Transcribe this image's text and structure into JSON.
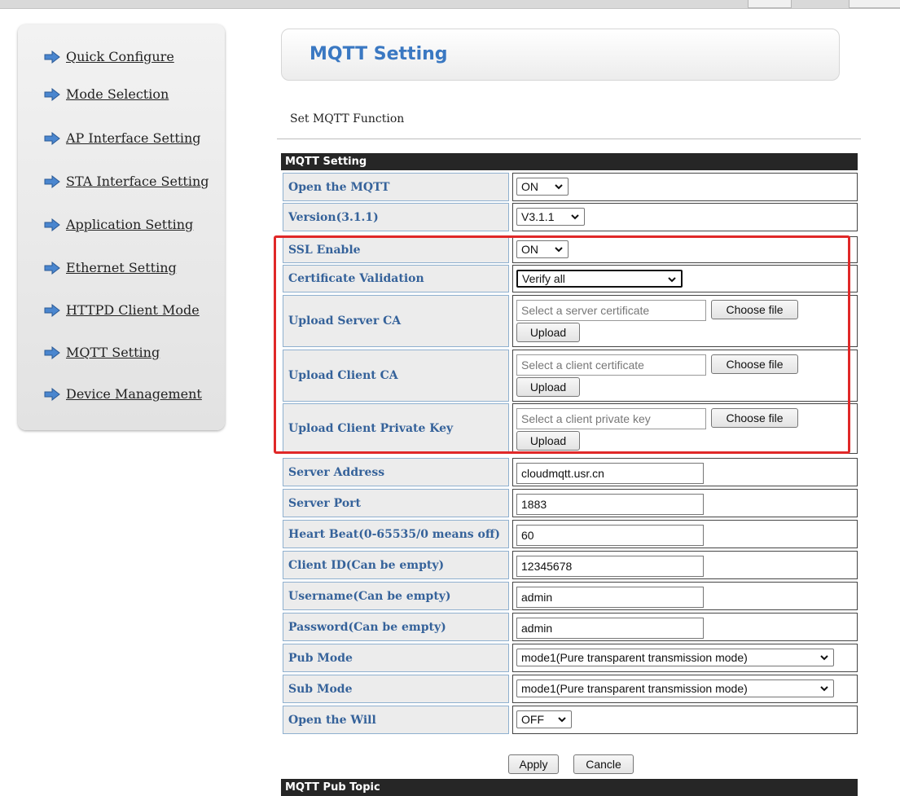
{
  "sidebar": {
    "items": [
      {
        "label": "Quick Configure"
      },
      {
        "label": "Mode Selection"
      },
      {
        "label": "AP Interface Setting"
      },
      {
        "label": "STA Interface Setting"
      },
      {
        "label": "Application Setting"
      },
      {
        "label": "Ethernet Setting"
      },
      {
        "label": "HTTPD Client Mode"
      },
      {
        "label": "MQTT Setting"
      },
      {
        "label": "Device Management"
      }
    ]
  },
  "header": {
    "title": "MQTT Setting"
  },
  "subtitle": "Set MQTT Function",
  "section": {
    "title": "MQTT Setting",
    "next_title": "MQTT Pub Topic"
  },
  "fields": {
    "open_mqtt": {
      "label": "Open the MQTT",
      "value": "ON"
    },
    "version": {
      "label": "Version(3.1.1)",
      "value": "V3.1.1"
    },
    "ssl_enable": {
      "label": "SSL Enable",
      "value": "ON"
    },
    "cert_validation": {
      "label": "Certificate Validation",
      "value": "Verify all"
    },
    "server_ca": {
      "label": "Upload Server CA",
      "placeholder": "Select a server certificate",
      "choose": "Choose file",
      "upload": "Upload"
    },
    "client_ca": {
      "label": "Upload Client CA",
      "placeholder": "Select a client certificate",
      "choose": "Choose file",
      "upload": "Upload"
    },
    "client_key": {
      "label": "Upload Client Private Key",
      "placeholder": "Select a client private key",
      "choose": "Choose file",
      "upload": "Upload"
    },
    "server_address": {
      "label": "Server Address",
      "value": "cloudmqtt.usr.cn"
    },
    "server_port": {
      "label": "Server Port",
      "value": "1883"
    },
    "heart_beat": {
      "label": "Heart Beat(0-65535/0 means off)",
      "value": "60"
    },
    "client_id": {
      "label": "Client ID(Can be empty)",
      "value": "12345678"
    },
    "username": {
      "label": "Username(Can be empty)",
      "value": "admin"
    },
    "password": {
      "label": "Password(Can be empty)",
      "value": "admin"
    },
    "pub_mode": {
      "label": "Pub Mode",
      "value": "mode1(Pure transparent transmission mode)"
    },
    "sub_mode": {
      "label": "Sub Mode",
      "value": "mode1(Pure transparent transmission mode)"
    },
    "open_will": {
      "label": "Open the Will",
      "value": "OFF"
    }
  },
  "actions": {
    "apply": "Apply",
    "cancel": "Cancle"
  },
  "colors": {
    "title_blue": "#3a78c2",
    "label_blue": "#35629a",
    "highlight_red": "#e02828",
    "bar_dark": "#262626"
  },
  "icons": {
    "nav_arrow": "arrow-right-icon",
    "dropdown": "chevron-down-icon"
  }
}
